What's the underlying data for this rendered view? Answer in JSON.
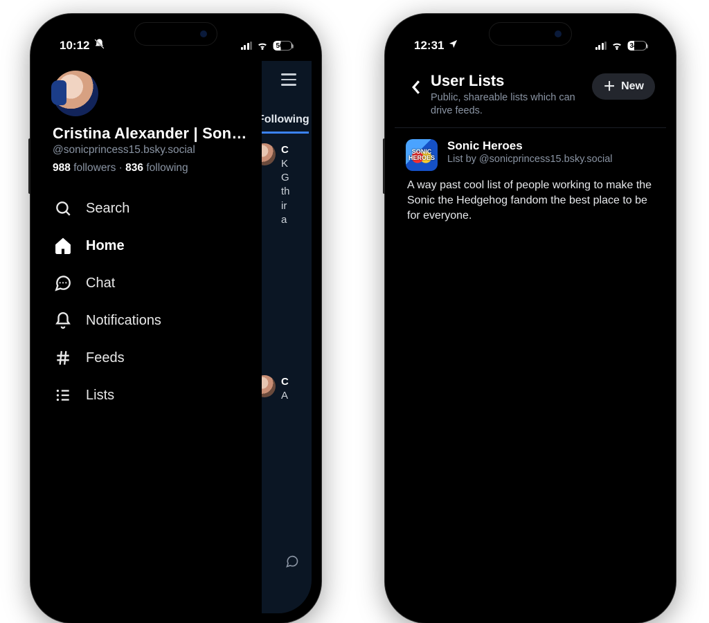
{
  "left": {
    "status": {
      "time": "10:12",
      "battery": "50"
    },
    "profile": {
      "display_name": "Cristina Alexander | SonicP...",
      "handle": "@sonicprincess15.bsky.social",
      "followers_count": "988",
      "followers_label": "followers",
      "following_count": "836",
      "following_label": "following"
    },
    "nav": {
      "search": "Search",
      "home": "Home",
      "chat": "Chat",
      "notifications": "Notifications",
      "feeds": "Feeds",
      "lists": "Lists"
    },
    "feed": {
      "tab": "Following",
      "post1": {
        "name": "C",
        "l1": "K",
        "l2": "G",
        "l3": "th",
        "l4": "ir",
        "l5": "a"
      },
      "post2": {
        "name": "C",
        "l1": "A"
      }
    }
  },
  "right": {
    "status": {
      "time": "12:31",
      "battery": "34"
    },
    "header": {
      "title": "User Lists",
      "subtitle": "Public, shareable lists which can drive feeds.",
      "new_label": "New"
    },
    "list": {
      "icon_text": "SONIC\nHEROES",
      "name": "Sonic Heroes",
      "byline": "List by @sonicprincess15.bsky.social",
      "description": "A way past cool list of people working to make the Sonic the Hedgehog fandom the best place to be for everyone."
    }
  }
}
